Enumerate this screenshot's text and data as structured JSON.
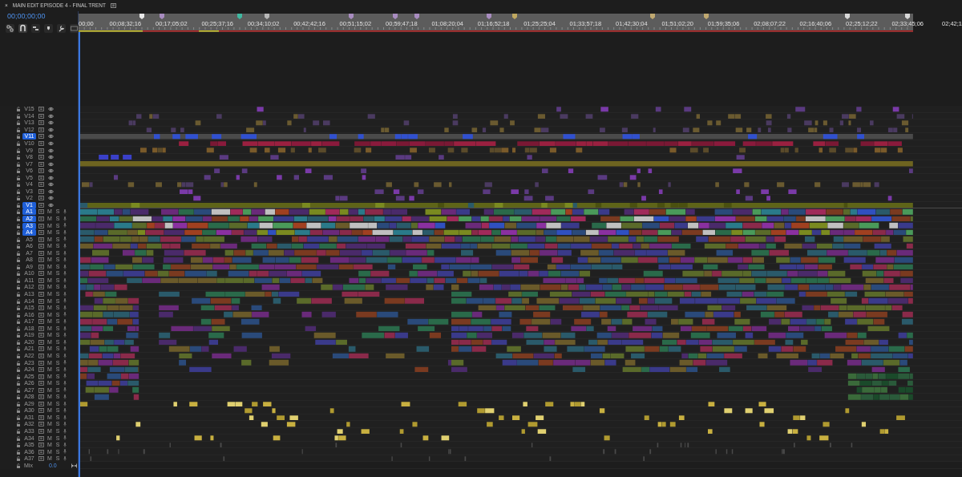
{
  "window": {
    "close_glyph": "×",
    "title": "MAIN EDIT EPISODE 4 - FINAL TRENT"
  },
  "timecode": "00;00;00;00",
  "ruler": {
    "labels": [
      "00;00",
      "00;08;32;16",
      "00;17;05;02",
      "00;25;37;16",
      "00;34;10;02",
      "00;42;42;16",
      "00;51;15;02",
      "00;59;47;18",
      "01;08;20;04",
      "01;16;52;18",
      "01;25;25;04",
      "01;33;57;18",
      "01;42;30;04",
      "01;51;02;20",
      "01;59;35;06",
      "02;08;07;22",
      "02;16;40;06",
      "02;25;12;22",
      "02;33;45;06",
      "02;42;1"
    ],
    "markers": [
      {
        "color": "#e8e8e8"
      },
      {
        "color": "#a88cc0"
      },
      {
        "color": "#3fb8a0"
      },
      {
        "color": "#b8b8b8"
      },
      {
        "color": "#a88cc0"
      },
      {
        "color": "#a88cc0"
      },
      {
        "color": "#a88cc0"
      },
      {
        "color": "#a88cc0"
      },
      {
        "color": "#c0a860"
      },
      {
        "color": "#c0a870"
      },
      {
        "color": "#c0a870"
      },
      {
        "color": "#d8d8d8"
      },
      {
        "color": "#d8d8d8"
      }
    ]
  },
  "tracks": [
    {
      "label": "V15",
      "kind": "video",
      "targeted": false
    },
    {
      "label": "V14",
      "kind": "video",
      "targeted": false
    },
    {
      "label": "V13",
      "kind": "video",
      "targeted": false
    },
    {
      "label": "V12",
      "kind": "video",
      "targeted": false
    },
    {
      "label": "V11",
      "kind": "video",
      "targeted": true
    },
    {
      "label": "V10",
      "kind": "video",
      "targeted": false
    },
    {
      "label": "V9",
      "kind": "video",
      "targeted": false
    },
    {
      "label": "V8",
      "kind": "video",
      "targeted": false
    },
    {
      "label": "V7",
      "kind": "video",
      "targeted": false
    },
    {
      "label": "V6",
      "kind": "video",
      "targeted": false
    },
    {
      "label": "V5",
      "kind": "video",
      "targeted": false
    },
    {
      "label": "V4",
      "kind": "video",
      "targeted": false
    },
    {
      "label": "V3",
      "kind": "video",
      "targeted": false
    },
    {
      "label": "V2",
      "kind": "video",
      "targeted": false
    },
    {
      "label": "V1",
      "kind": "video",
      "targeted": true
    },
    {
      "label": "A1",
      "kind": "audio",
      "targeted": true,
      "mute_label": "M",
      "solo_label": "S"
    },
    {
      "label": "A2",
      "kind": "audio",
      "targeted": true,
      "mute_label": "M",
      "solo_label": "S"
    },
    {
      "label": "A3",
      "kind": "audio",
      "targeted": true,
      "mute_label": "M",
      "solo_label": "S"
    },
    {
      "label": "A4",
      "kind": "audio",
      "targeted": true,
      "mute_label": "M",
      "solo_label": "S"
    },
    {
      "label": "A5",
      "kind": "audio",
      "targeted": false,
      "mute_label": "M",
      "solo_label": "S"
    },
    {
      "label": "A6",
      "kind": "audio",
      "targeted": false,
      "mute_label": "M",
      "solo_label": "S"
    },
    {
      "label": "A7",
      "kind": "audio",
      "targeted": false,
      "mute_label": "M",
      "solo_label": "S"
    },
    {
      "label": "A8",
      "kind": "audio",
      "targeted": false,
      "mute_label": "M",
      "solo_label": "S"
    },
    {
      "label": "A9",
      "kind": "audio",
      "targeted": false,
      "mute_label": "M",
      "solo_label": "S"
    },
    {
      "label": "A10",
      "kind": "audio",
      "targeted": false,
      "mute_label": "M",
      "solo_label": "S"
    },
    {
      "label": "A11",
      "kind": "audio",
      "targeted": false,
      "mute_label": "M",
      "solo_label": "S"
    },
    {
      "label": "A12",
      "kind": "audio",
      "targeted": false,
      "mute_label": "M",
      "solo_label": "S"
    },
    {
      "label": "A13",
      "kind": "audio",
      "targeted": false,
      "mute_label": "M",
      "solo_label": "S"
    },
    {
      "label": "A14",
      "kind": "audio",
      "targeted": false,
      "mute_label": "M",
      "solo_label": "S"
    },
    {
      "label": "A15",
      "kind": "audio",
      "targeted": false,
      "mute_label": "M",
      "solo_label": "S"
    },
    {
      "label": "A16",
      "kind": "audio",
      "targeted": false,
      "mute_label": "M",
      "solo_label": "S"
    },
    {
      "label": "A17",
      "kind": "audio",
      "targeted": false,
      "mute_label": "M",
      "solo_label": "S"
    },
    {
      "label": "A18",
      "kind": "audio",
      "targeted": false,
      "mute_label": "M",
      "solo_label": "S"
    },
    {
      "label": "A19",
      "kind": "audio",
      "targeted": false,
      "mute_label": "M",
      "solo_label": "S"
    },
    {
      "label": "A20",
      "kind": "audio",
      "targeted": false,
      "mute_label": "M",
      "solo_label": "S"
    },
    {
      "label": "A21",
      "kind": "audio",
      "targeted": false,
      "mute_label": "M",
      "solo_label": "S"
    },
    {
      "label": "A22",
      "kind": "audio",
      "targeted": false,
      "mute_label": "M",
      "solo_label": "S"
    },
    {
      "label": "A23",
      "kind": "audio",
      "targeted": false,
      "mute_label": "M",
      "solo_label": "S"
    },
    {
      "label": "A24",
      "kind": "audio",
      "targeted": false,
      "mute_label": "M",
      "solo_label": "S"
    },
    {
      "label": "A25",
      "kind": "audio",
      "targeted": false,
      "mute_label": "M",
      "solo_label": "S"
    },
    {
      "label": "A26",
      "kind": "audio",
      "targeted": false,
      "mute_label": "M",
      "solo_label": "S"
    },
    {
      "label": "A27",
      "kind": "audio",
      "targeted": false,
      "mute_label": "M",
      "solo_label": "S"
    },
    {
      "label": "A28",
      "kind": "audio",
      "targeted": false,
      "mute_label": "M",
      "solo_label": "S"
    },
    {
      "label": "A29",
      "kind": "audio",
      "targeted": false,
      "mute_label": "M",
      "solo_label": "S"
    },
    {
      "label": "A30",
      "kind": "audio",
      "targeted": false,
      "mute_label": "M",
      "solo_label": "S"
    },
    {
      "label": "A31",
      "kind": "audio",
      "targeted": false,
      "mute_label": "M",
      "solo_label": "S"
    },
    {
      "label": "A32",
      "kind": "audio",
      "targeted": false,
      "mute_label": "M",
      "solo_label": "S"
    },
    {
      "label": "A33",
      "kind": "audio",
      "targeted": false,
      "mute_label": "M",
      "solo_label": "S"
    },
    {
      "label": "A34",
      "kind": "audio",
      "targeted": false,
      "mute_label": "M",
      "solo_label": "S"
    },
    {
      "label": "A35",
      "kind": "audio",
      "targeted": false,
      "mute_label": "M",
      "solo_label": "S"
    },
    {
      "label": "A36",
      "kind": "audio",
      "targeted": false,
      "mute_label": "M",
      "solo_label": "S"
    },
    {
      "label": "A37",
      "kind": "audio",
      "targeted": false,
      "mute_label": "M",
      "solo_label": "S"
    }
  ],
  "mix": {
    "label": "Mix",
    "value": "0.0"
  }
}
